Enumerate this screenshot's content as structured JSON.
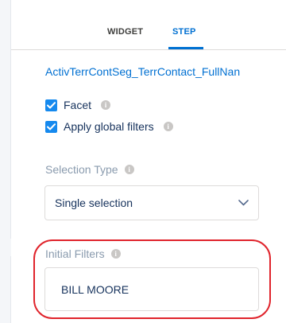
{
  "tabs": [
    {
      "label": "WIDGET",
      "active": false
    },
    {
      "label": "STEP",
      "active": true
    }
  ],
  "step": {
    "name": "ActivTerrContSeg_TerrContact_FullNan"
  },
  "options": {
    "facet": {
      "label": "Facet",
      "checked": true
    },
    "apply_global_filters": {
      "label": "Apply global filters",
      "checked": true
    }
  },
  "selection_type": {
    "label": "Selection Type",
    "value": "Single selection"
  },
  "initial_filters": {
    "label": "Initial Filters",
    "value": "BILL MOORE"
  },
  "icons": {
    "info": "info-icon",
    "check": "checkmark-icon",
    "dropdown": "chevron-down-icon"
  },
  "colors": {
    "accent": "#0070d2",
    "checkbox": "#1589ee",
    "highlight": "#e0242c",
    "label": "#8a9bae",
    "text": "#16325c"
  }
}
